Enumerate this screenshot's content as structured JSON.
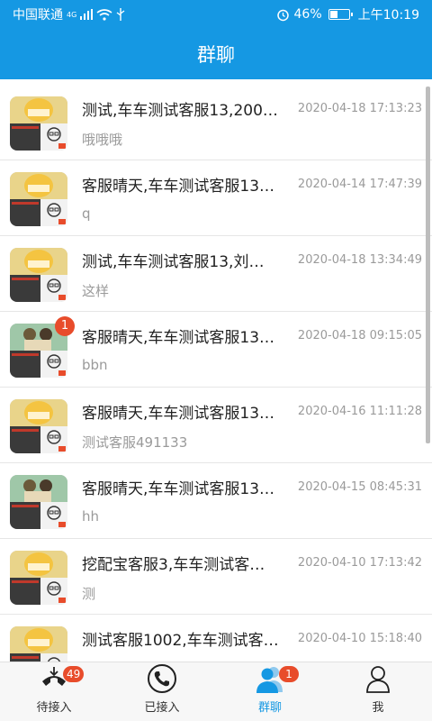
{
  "status_bar": {
    "carrier": "中国联通",
    "network_sup": "4G",
    "battery_percent": "46%",
    "time": "上午10:19",
    "battery_level": 0.46
  },
  "header": {
    "title": "群聊"
  },
  "colors": {
    "primary": "#1598e3",
    "badge": "#e84c2b",
    "muted": "#9a9a9a"
  },
  "conversations": [
    {
      "title": "测试,车车测试客服13,200…",
      "time": "2020-04-18 17:13:23",
      "preview": "哦哦哦",
      "badge": "",
      "avatar": "cartoon-collage-avatar"
    },
    {
      "title": "客服晴天,车车测试客服13…",
      "time": "2020-04-14 17:47:39",
      "preview": "q",
      "badge": "",
      "avatar": "cartoon-collage-avatar"
    },
    {
      "title": "测试,车车测试客服13,刘…",
      "time": "2020-04-18 13:34:49",
      "preview": "这样",
      "badge": "",
      "avatar": "cartoon-collage-avatar"
    },
    {
      "title": "客服晴天,车车测试客服13…",
      "time": "2020-04-18 09:15:05",
      "preview": "bbn",
      "badge": "1",
      "avatar": "anime-collage-avatar"
    },
    {
      "title": "客服晴天,车车测试客服13…",
      "time": "2020-04-16 11:11:28",
      "preview": "测试客服491133",
      "badge": "",
      "avatar": "cartoon-collage-avatar"
    },
    {
      "title": "客服晴天,车车测试客服13…",
      "time": "2020-04-15 08:45:31",
      "preview": "hh",
      "badge": "",
      "avatar": "anime-collage-avatar"
    },
    {
      "title": "挖配宝客服3,车车测试客…",
      "time": "2020-04-10 17:13:42",
      "preview": "测",
      "badge": "",
      "avatar": "cartoon-collage-avatar"
    },
    {
      "title": "测试客服1002,车车测试客…",
      "time": "2020-04-10 15:18:40",
      "preview": "",
      "badge": "",
      "avatar": "cartoon-collage-avatar"
    }
  ],
  "tabs": [
    {
      "label": "待接入",
      "badge": "49",
      "icon": "incoming-call-icon"
    },
    {
      "label": "已接入",
      "badge": "",
      "icon": "phone-icon"
    },
    {
      "label": "群聊",
      "badge": "1",
      "icon": "group-users-icon"
    },
    {
      "label": "我",
      "badge": "",
      "icon": "user-icon"
    }
  ]
}
